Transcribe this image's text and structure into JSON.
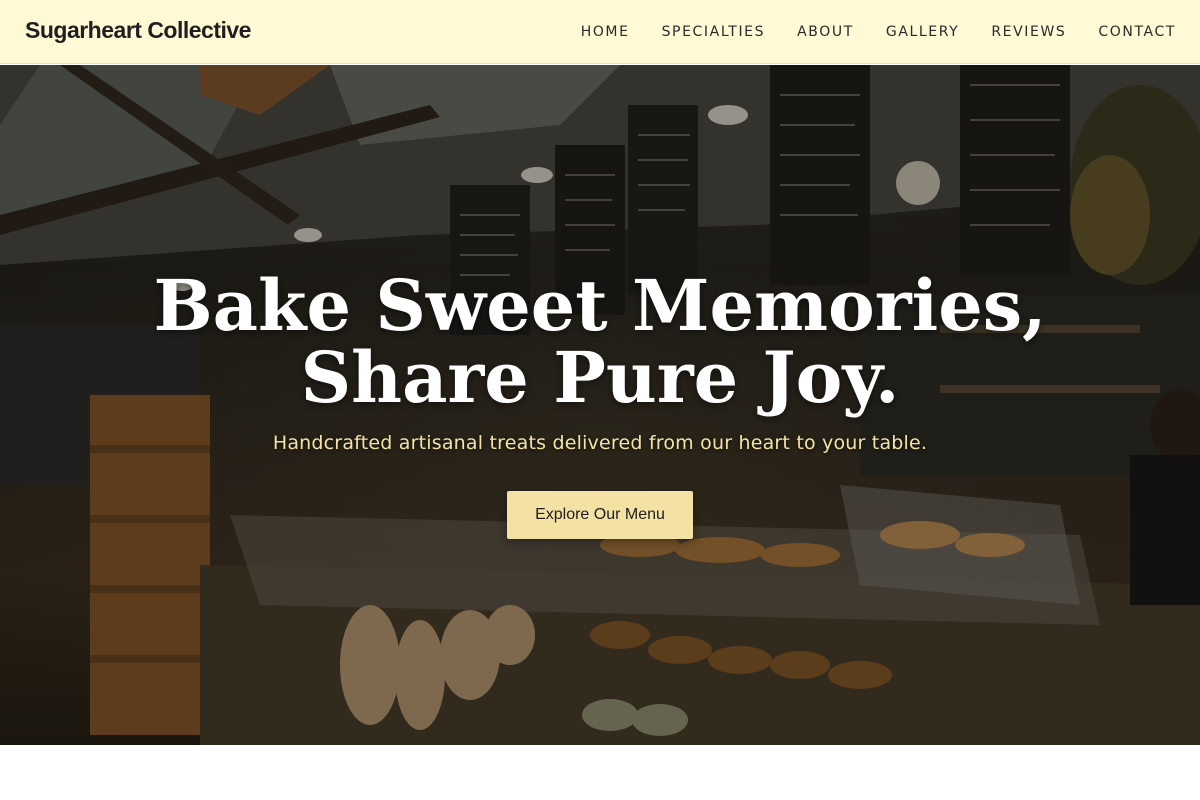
{
  "brand": {
    "name": "Sugarheart Collective"
  },
  "nav": {
    "items": [
      {
        "label": "HOME"
      },
      {
        "label": "SPECIALTIES"
      },
      {
        "label": "ABOUT"
      },
      {
        "label": "GALLERY"
      },
      {
        "label": "REVIEWS"
      },
      {
        "label": "CONTACT"
      }
    ]
  },
  "hero": {
    "headline_line1": "Bake Sweet Memories,",
    "headline_line2": "Share Pure Joy.",
    "subheadline": "Handcrafted artisanal treats delivered from our heart to your table.",
    "cta_label": "Explore Our Menu",
    "image": "bakery-interior-photo"
  },
  "colors": {
    "header_bg": "#fff9d6",
    "cta_bg": "#f4e2a4",
    "subhead_text": "#f3e3a8"
  }
}
